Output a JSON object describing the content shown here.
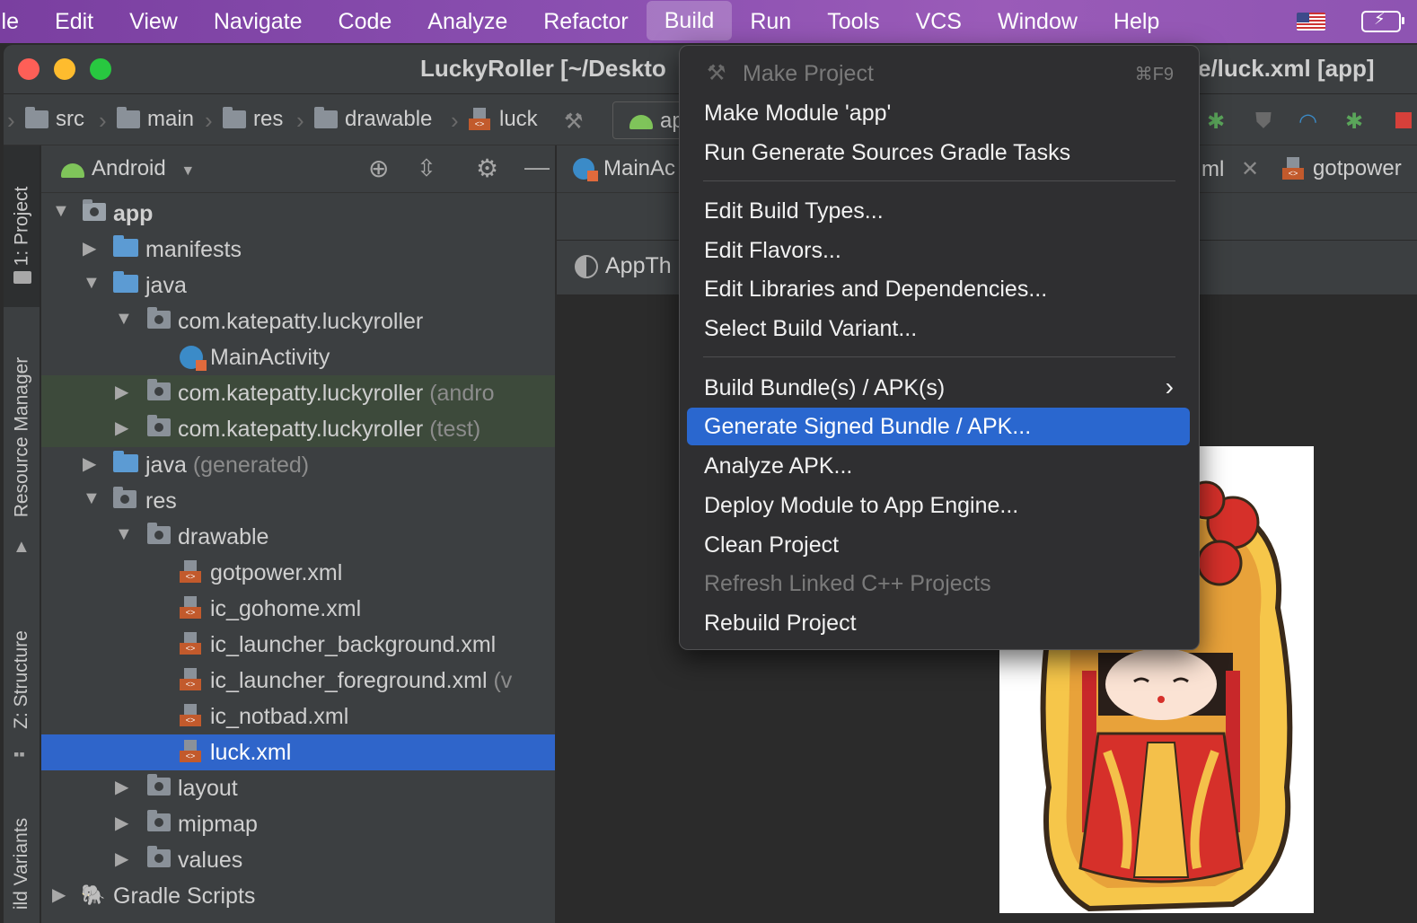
{
  "menubar": {
    "items": [
      "ile",
      "Edit",
      "View",
      "Navigate",
      "Code",
      "Analyze",
      "Refactor",
      "Build",
      "Run",
      "Tools",
      "VCS",
      "Window",
      "Help"
    ],
    "active_item": "Build",
    "flag_icon": "us-flag-icon",
    "battery_icon": "battery-charging-icon"
  },
  "window": {
    "title_left": "LuckyRoller [~/Deskto",
    "title_right": "e/luck.xml [app]"
  },
  "breadcrumb": {
    "items": [
      "src",
      "main",
      "res",
      "drawable",
      "luck"
    ],
    "run_config_label": "ap"
  },
  "tool_strip": {
    "project_tab": "1: Project",
    "resource_tab": "Resource Manager",
    "structure_tab": "Z: Structure",
    "variants_tab": "ild Variants"
  },
  "project_panel": {
    "view_label": "Android",
    "tree": [
      {
        "label": "app",
        "suffix": ""
      },
      {
        "label": "manifests",
        "suffix": ""
      },
      {
        "label": "java",
        "suffix": ""
      },
      {
        "label": "com.katepatty.luckyroller",
        "suffix": ""
      },
      {
        "label": "MainActivity",
        "suffix": ""
      },
      {
        "label": "com.katepatty.luckyroller",
        "suffix": "(andro"
      },
      {
        "label": "com.katepatty.luckyroller",
        "suffix": "(test)"
      },
      {
        "label": "java",
        "suffix": "(generated)"
      },
      {
        "label": "res",
        "suffix": ""
      },
      {
        "label": "drawable",
        "suffix": ""
      },
      {
        "label": "gotpower.xml",
        "suffix": ""
      },
      {
        "label": "ic_gohome.xml",
        "suffix": ""
      },
      {
        "label": "ic_launcher_background.xml",
        "suffix": ""
      },
      {
        "label": "ic_launcher_foreground.xml",
        "suffix": "(v"
      },
      {
        "label": "ic_notbad.xml",
        "suffix": ""
      },
      {
        "label": "luck.xml",
        "suffix": ""
      },
      {
        "label": "layout",
        "suffix": ""
      },
      {
        "label": "mipmap",
        "suffix": ""
      },
      {
        "label": "values",
        "suffix": ""
      },
      {
        "label": "Gradle Scripts",
        "suffix": ""
      }
    ]
  },
  "editor": {
    "tab_main": "MainAc",
    "tab_xml": "ml",
    "tab_gotpower": "gotpower",
    "theme_label": "AppTh"
  },
  "build_menu": {
    "items": [
      {
        "label": "Make Project",
        "shortcut": "⌘F9",
        "disabled": true
      },
      {
        "label": "Make Module 'app'"
      },
      {
        "label": "Run Generate Sources Gradle Tasks"
      },
      {
        "label": "Edit Build Types..."
      },
      {
        "label": "Edit Flavors..."
      },
      {
        "label": "Edit Libraries and Dependencies..."
      },
      {
        "label": "Select Build Variant..."
      },
      {
        "label": "Build Bundle(s) / APK(s)",
        "submenu": true
      },
      {
        "label": "Generate Signed Bundle / APK...",
        "highlighted": true
      },
      {
        "label": "Analyze APK..."
      },
      {
        "label": "Deploy Module to App Engine..."
      },
      {
        "label": "Clean Project"
      },
      {
        "label": "Refresh Linked C++ Projects",
        "disabled": true
      },
      {
        "label": "Rebuild Project"
      }
    ],
    "highlight_color": "#2a67cf"
  }
}
